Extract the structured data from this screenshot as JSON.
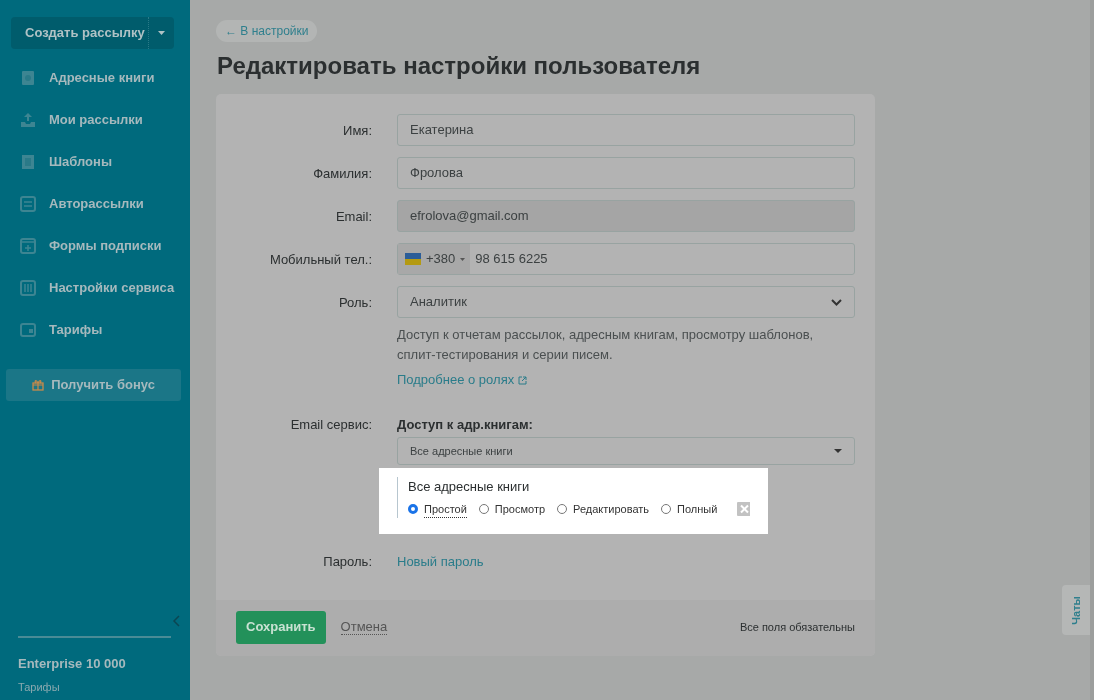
{
  "sidebar": {
    "create_button": "Создать рассылку",
    "items": [
      {
        "label": "Адресные книги"
      },
      {
        "label": "Мои рассылки"
      },
      {
        "label": "Шаблоны"
      },
      {
        "label": "Авторассылки"
      },
      {
        "label": "Формы подписки"
      },
      {
        "label": "Настройки сервиса"
      },
      {
        "label": "Тарифы"
      }
    ],
    "bonus_button": "Получить бонус",
    "plan": {
      "name": "Enterprise 10 000",
      "link": "Тарифы"
    }
  },
  "back_link": "← В настройки",
  "title": "Редактировать настройки пользователя",
  "fields": [
    {
      "label": "Имя:",
      "kind": "text",
      "value": "Екатерина",
      "disabled": false
    },
    {
      "label": "Фамилия:",
      "kind": "text",
      "value": "Фролова",
      "disabled": false
    },
    {
      "label": "Email:",
      "kind": "text",
      "value": "efrolova@gmail.com",
      "disabled": true
    },
    {
      "label": "Мобильный тел.:",
      "kind": "phone",
      "country_code": "+380",
      "value": "98 615 6225",
      "disabled": false
    },
    {
      "label": "Роль:",
      "kind": "select",
      "value": "Аналитик",
      "description": "Доступ к отчетам рассылок, адресным книгам, просмотру шаблонов, сплит-тестирования и серии писем.",
      "link": "Подробнее о ролях",
      "disabled": false
    },
    {
      "label": "Email сервис:",
      "kind": "access",
      "subtitle": "Доступ к адр.книгам:",
      "value": "Все адресные книги",
      "disabled": false,
      "popup": {
        "title": "Все адресные книги",
        "options": [
          {
            "label": "Простой",
            "selected": true
          },
          {
            "label": "Просмотр",
            "selected": false
          },
          {
            "label": "Редактировать",
            "selected": false
          },
          {
            "label": "Полный",
            "selected": false
          }
        ]
      }
    },
    {
      "label": "Пароль:",
      "kind": "link",
      "link": "Новый пароль",
      "disabled": false
    }
  ],
  "footer": {
    "save": "Сохранить",
    "cancel": "Отмена",
    "note": "Все поля обязательны"
  },
  "chat_tab": "Чаты"
}
